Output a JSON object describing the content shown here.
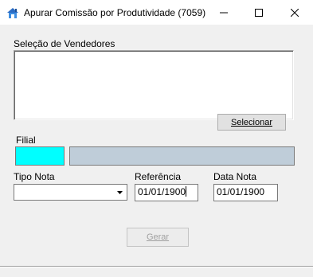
{
  "window": {
    "title": "Apurar Comissão por Produtividade (7059)",
    "controls": [
      "minimize-icon",
      "maximize-icon",
      "close-icon"
    ]
  },
  "vendedores": {
    "label": "Seleção de Vendedores",
    "select_button": "Selecionar"
  },
  "filial": {
    "label": "Filial",
    "code_color": "#00ffff",
    "name_color": "#bfcdd9"
  },
  "tipo_nota": {
    "label": "Tipo Nota",
    "value": ""
  },
  "referencia": {
    "label": "Referência",
    "value": "01/01/1900"
  },
  "data_nota": {
    "label": "Data Nota",
    "value": "01/01/1900"
  },
  "actions": {
    "gerar_label": "Gerar"
  }
}
